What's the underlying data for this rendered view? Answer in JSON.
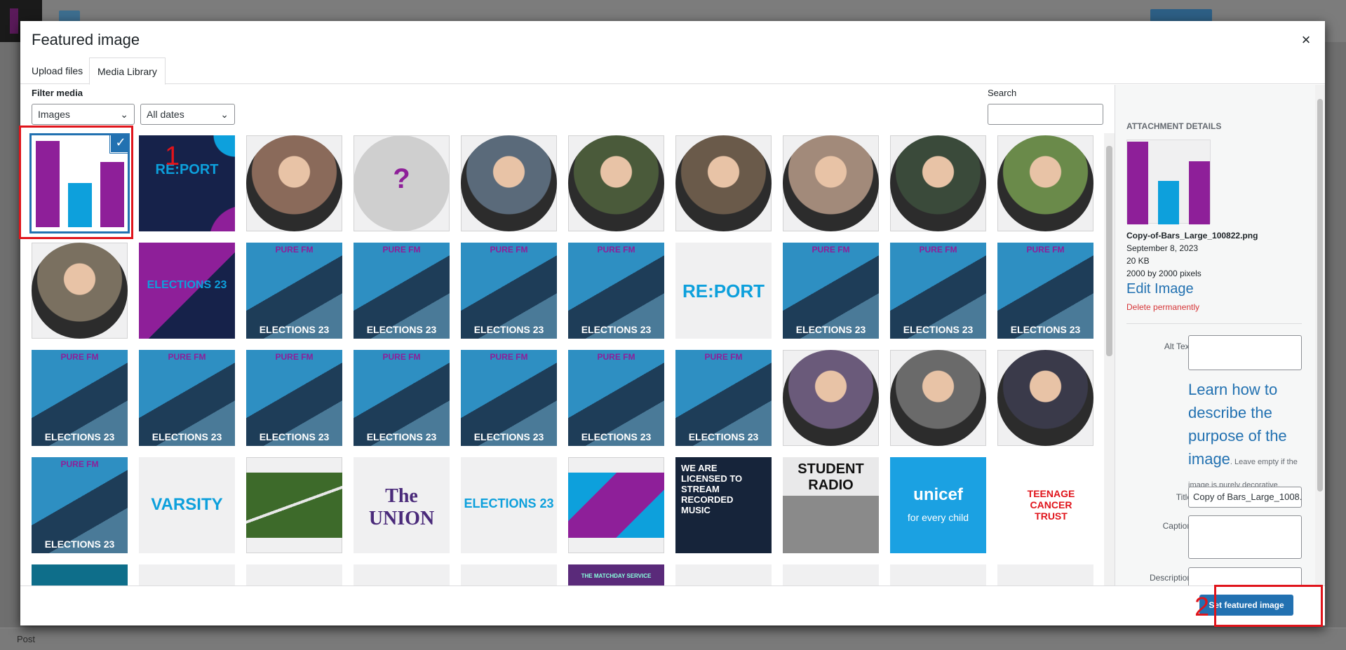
{
  "background": {
    "status_label": "Post"
  },
  "modal": {
    "title": "Featured image",
    "close_glyph": "×",
    "tabs": [
      {
        "label": "Upload files"
      },
      {
        "label": "Media Library"
      }
    ],
    "filter_label": "Filter media",
    "type_filter": "Images",
    "date_filter": "All dates",
    "search_label": "Search",
    "search_value": ""
  },
  "library": {
    "rows": [
      [
        {
          "kind": "bars",
          "selected": true
        },
        {
          "kind": "report-dark",
          "text": "RE:PORT"
        },
        {
          "kind": "portrait",
          "tone": "#8a6a5a"
        },
        {
          "kind": "placeholder",
          "text": "?"
        },
        {
          "kind": "portrait",
          "tone": "#5a6a7a"
        },
        {
          "kind": "portrait",
          "tone": "#4a5a3a"
        },
        {
          "kind": "portrait",
          "tone": "#6a5a4a"
        },
        {
          "kind": "portrait",
          "tone": "#a28a7a"
        },
        {
          "kind": "portrait",
          "tone": "#3a4a3a"
        },
        {
          "kind": "portrait",
          "tone": "#6a8a4a"
        }
      ],
      [
        {
          "kind": "portrait",
          "tone": "#7a7060"
        },
        {
          "kind": "elections-purple",
          "text": "ELECTIONS 23"
        },
        {
          "kind": "purefm",
          "text": "ELECTIONS 23",
          "brand": "PURE FM"
        },
        {
          "kind": "purefm",
          "text": "ELECTIONS 23",
          "brand": "PURE FM"
        },
        {
          "kind": "purefm",
          "text": "ELECTIONS 23",
          "brand": "PURE FM"
        },
        {
          "kind": "purefm",
          "text": "ELECTIONS 23",
          "brand": "PURE FM"
        },
        {
          "kind": "report-light",
          "text": "RE:PORT"
        },
        {
          "kind": "purefm",
          "text": "ELECTIONS 23",
          "brand": "PURE FM"
        },
        {
          "kind": "purefm",
          "text": "ELECTIONS 23",
          "brand": "PURE FM"
        },
        {
          "kind": "purefm",
          "text": "ELECTIONS 23",
          "brand": "PURE FM"
        }
      ],
      [
        {
          "kind": "purefm",
          "text": "ELECTIONS 23",
          "brand": "PURE FM"
        },
        {
          "kind": "purefm",
          "text": "ELECTIONS 23",
          "brand": "PURE FM"
        },
        {
          "kind": "purefm",
          "text": "ELECTIONS 23",
          "brand": "PURE FM"
        },
        {
          "kind": "purefm",
          "text": "ELECTIONS 23",
          "brand": "PURE FM"
        },
        {
          "kind": "purefm",
          "text": "ELECTIONS 23",
          "brand": "PURE FM"
        },
        {
          "kind": "purefm",
          "text": "ELECTIONS 23",
          "brand": "PURE FM"
        },
        {
          "kind": "purefm",
          "text": "ELECTIONS 23",
          "brand": "PURE FM"
        },
        {
          "kind": "portrait",
          "tone": "#6a5a7a"
        },
        {
          "kind": "portrait",
          "tone": "#6a6a6a"
        },
        {
          "kind": "portrait",
          "tone": "#3a3a4a"
        }
      ],
      [
        {
          "kind": "purefm",
          "text": "ELECTIONS 23",
          "brand": "PURE FM"
        },
        {
          "kind": "varsity",
          "text": "VARSITY"
        },
        {
          "kind": "grass"
        },
        {
          "kind": "union",
          "text": "The UNION"
        },
        {
          "kind": "elections-light",
          "text": "ELECTIONS 23"
        },
        {
          "kind": "geo-purple"
        },
        {
          "kind": "licensed",
          "text": "WE ARE LICENSED TO STREAM RECORDED MUSIC"
        },
        {
          "kind": "student-radio",
          "text": "STUDENT RADIO"
        },
        {
          "kind": "unicef",
          "text": "unicef",
          "sub": "for every child"
        },
        {
          "kind": "tct",
          "text": "TEENAGE CANCER TRUST"
        }
      ],
      [
        {
          "kind": "partial-teal"
        },
        {
          "kind": "blank"
        },
        {
          "kind": "blank"
        },
        {
          "kind": "blank"
        },
        {
          "kind": "blank"
        },
        {
          "kind": "partial-purple",
          "text": "THE MATCHDAY SERVICE"
        },
        {
          "kind": "blank"
        },
        {
          "kind": "blank"
        },
        {
          "kind": "blank"
        },
        {
          "kind": "blank"
        }
      ]
    ]
  },
  "annotations": {
    "step1": "1",
    "step2": "2"
  },
  "details": {
    "heading": "ATTACHMENT DETAILS",
    "filename": "Copy-of-Bars_Large_100822.png",
    "date": "September 8, 2023",
    "size": "20 KB",
    "dimensions": "2000 by 2000 pixels",
    "edit_label": "Edit Image",
    "delete_label": "Delete permanently",
    "alt_label": "Alt Text",
    "alt_value": "",
    "learn_link": "Learn how to describe the purpose of the image",
    "learn_note": ". Leave empty if the image is purely decorative.",
    "title_label": "Title",
    "title_value": "Copy of Bars_Large_1008.",
    "caption_label": "Caption",
    "caption_value": "",
    "description_label": "Description",
    "description_value": ""
  },
  "footer": {
    "primary_label": "Set featured image"
  },
  "colors": {
    "accent": "#2271b1",
    "purple": "#8e1f99",
    "cyan": "#0da0dc",
    "annotation": "#e0141b"
  }
}
